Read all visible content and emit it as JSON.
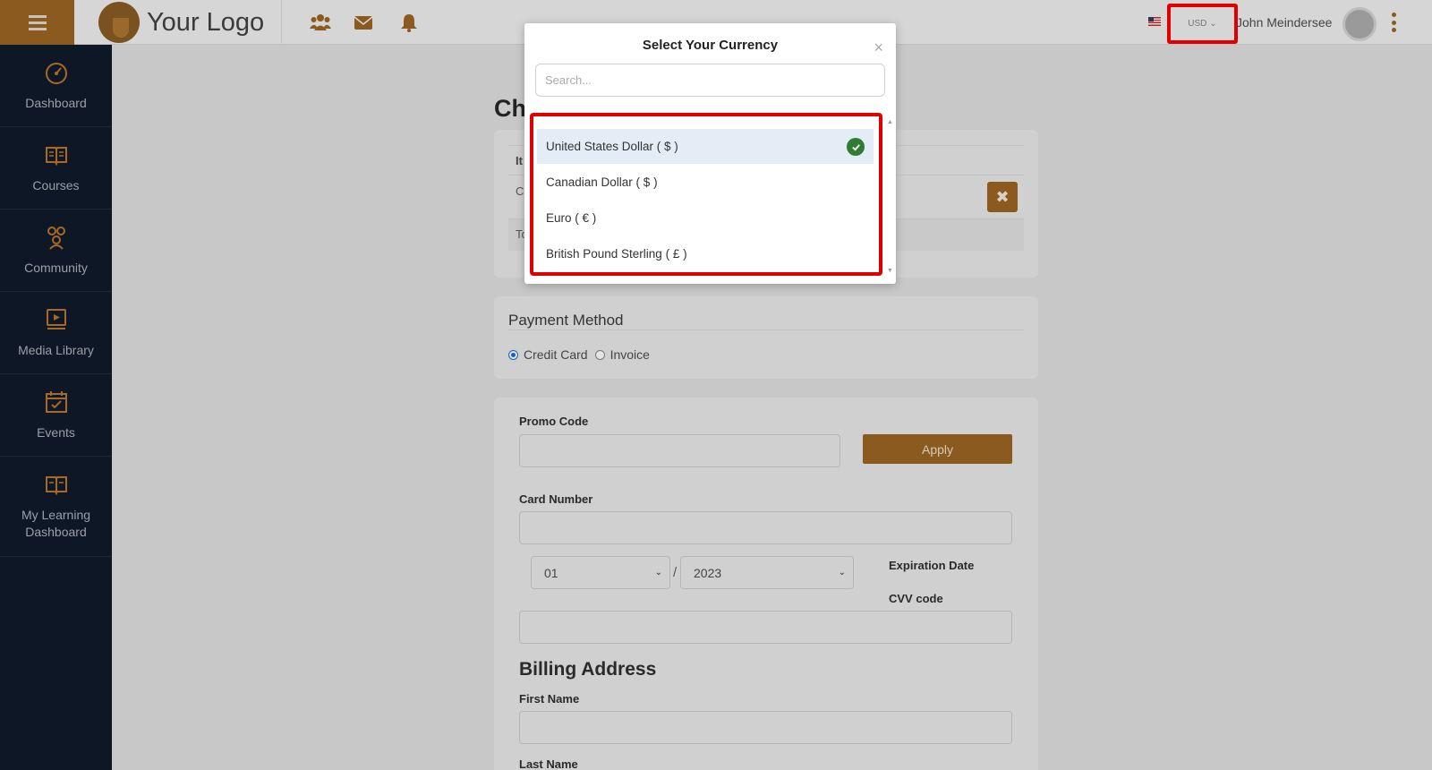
{
  "header": {
    "logo_text": "Your Logo",
    "currency_selected": "USD",
    "user_name": "John Meindersee"
  },
  "sidebar": {
    "items": [
      {
        "label": "Dashboard",
        "icon": "dashboard-icon"
      },
      {
        "label": "Courses",
        "icon": "book-icon"
      },
      {
        "label": "Community",
        "icon": "community-icon"
      },
      {
        "label": "Media Library",
        "icon": "media-library-icon"
      },
      {
        "label": "Events",
        "icon": "calendar-icon"
      },
      {
        "label": "My Learning Dashboard",
        "icon": "learning-book-icon"
      }
    ]
  },
  "main": {
    "title_fragment": "Ch",
    "order": {
      "header_fragment": "It",
      "row_fragment": "C",
      "total_fragment": "To"
    },
    "payment": {
      "title": "Payment Method",
      "options": [
        "Credit Card",
        "Invoice"
      ],
      "selected": "Credit Card"
    },
    "form": {
      "promo_label": "Promo Code",
      "apply_label": "Apply",
      "card_number_label": "Card Number",
      "month_value": "01",
      "year_value": "2023",
      "expiration_label": "Expiration Date",
      "cvv_label": "CVV code",
      "billing_title": "Billing Address",
      "first_name_label": "First Name",
      "last_name_label": "Last Name"
    }
  },
  "modal": {
    "title": "Select Your Currency",
    "close": "×",
    "search_placeholder": "Search...",
    "currencies": [
      {
        "label": "United States Dollar ( $ )",
        "selected": true
      },
      {
        "label": "Canadian Dollar ( $ )",
        "selected": false
      },
      {
        "label": "Euro ( € )",
        "selected": false
      },
      {
        "label": "British Pound Sterling ( £ )",
        "selected": false
      }
    ]
  },
  "colors": {
    "brand": "#8a5a1e",
    "sidebar": "#0e1726",
    "highlight": "#e00000",
    "check": "#2e7d32"
  }
}
